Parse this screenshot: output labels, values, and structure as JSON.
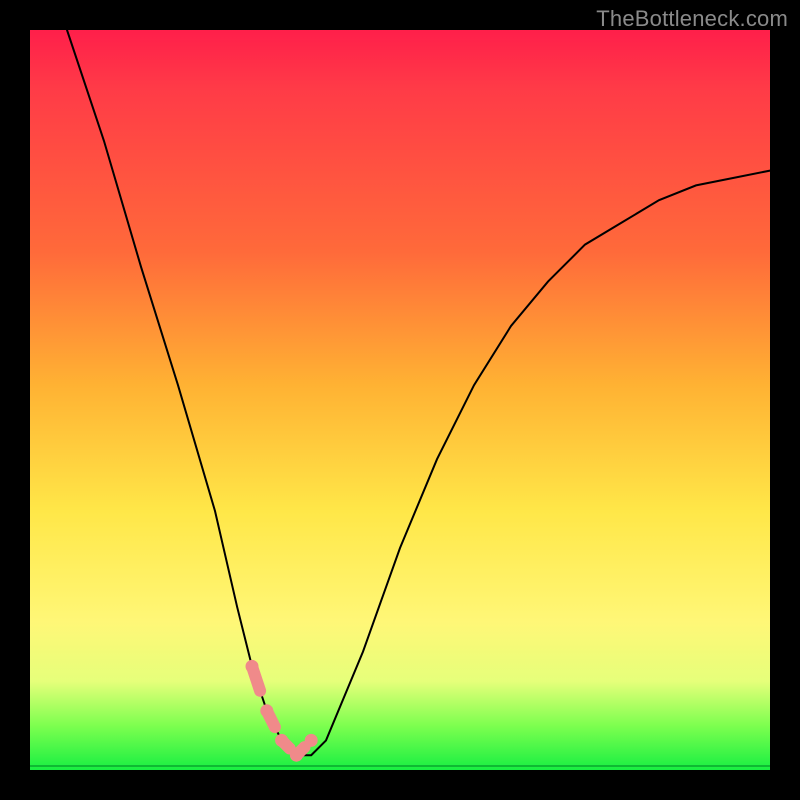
{
  "watermark": "TheBottleneck.com",
  "chart_data": {
    "type": "line",
    "title": "",
    "xlabel": "",
    "ylabel": "",
    "xlim": [
      0,
      100
    ],
    "ylim": [
      0,
      100
    ],
    "series": [
      {
        "name": "bottleneck-curve",
        "x": [
          5,
          10,
          15,
          20,
          25,
          28,
          30,
          32,
          34,
          36,
          38,
          40,
          45,
          50,
          55,
          60,
          65,
          70,
          75,
          80,
          85,
          90,
          95,
          100
        ],
        "y": [
          100,
          85,
          68,
          52,
          35,
          22,
          14,
          8,
          4,
          2,
          2,
          4,
          16,
          30,
          42,
          52,
          60,
          66,
          71,
          74,
          77,
          79,
          80,
          81
        ]
      }
    ],
    "highlight": {
      "name": "optimal-region",
      "x": [
        30,
        32,
        34,
        36,
        38
      ],
      "y": [
        14,
        8,
        4,
        2,
        4
      ]
    },
    "baseline": {
      "y": 0.5
    },
    "colors": {
      "curve": "#000000",
      "highlight": "#f08a8a",
      "gradient_top": "#ff1f4a",
      "gradient_mid": "#ffe748",
      "gradient_bottom": "#18ef42",
      "baseline": "#0fb933"
    }
  }
}
